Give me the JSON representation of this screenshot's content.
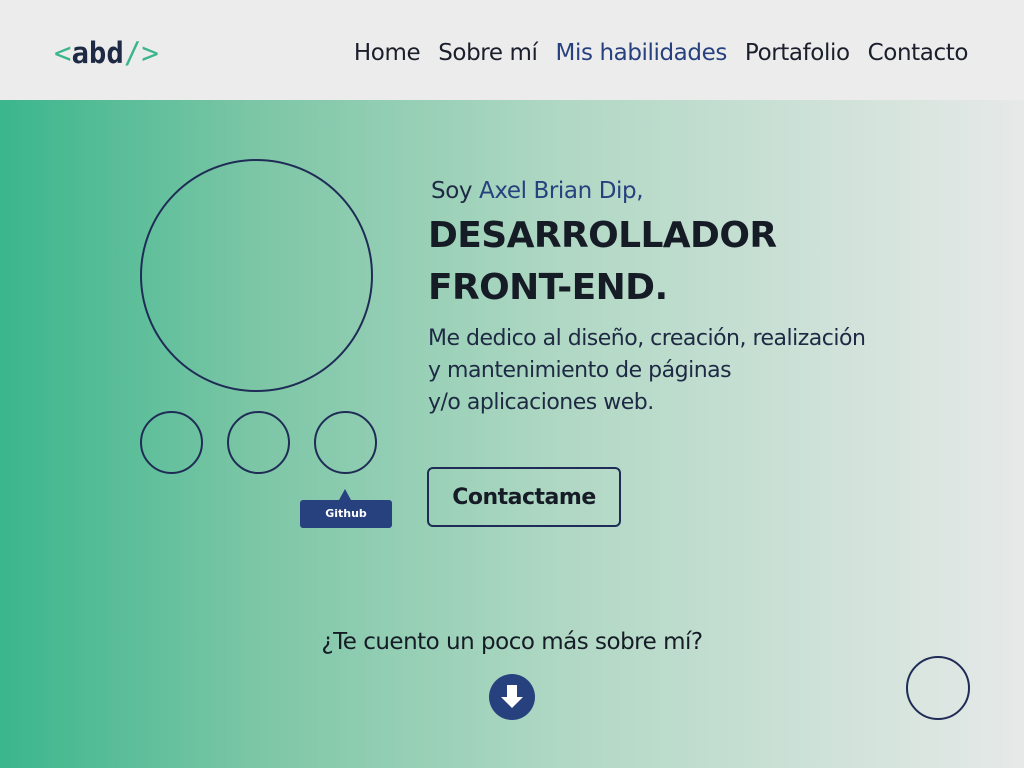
{
  "header": {
    "logo": {
      "open": "<",
      "core": "abd",
      "close": "/>"
    },
    "nav": [
      {
        "label": "Home",
        "active": false
      },
      {
        "label": "Sobre mí",
        "active": false
      },
      {
        "label": "Mis habilidades",
        "active": true
      },
      {
        "label": "Portafolio",
        "active": false
      },
      {
        "label": "Contacto",
        "active": false
      }
    ]
  },
  "hero": {
    "intro_prefix": "Soy ",
    "intro_name": "Axel Brian Dip,",
    "title_line1": "DESARROLLADOR",
    "title_line2": "FRONT-END.",
    "description_lines": [
      "Me dedico al diseño, creación, realización",
      "y mantenimiento de páginas",
      "y/o aplicaciones web."
    ],
    "cta_label": "Contactame",
    "tooltip": "Github"
  },
  "more": {
    "question": "¿Te cuento un poco más sobre mí?",
    "icon": "arrow-down-icon"
  },
  "colors": {
    "accent_green": "#3bb58c",
    "navy": "#27407e",
    "dark": "#161c26"
  }
}
